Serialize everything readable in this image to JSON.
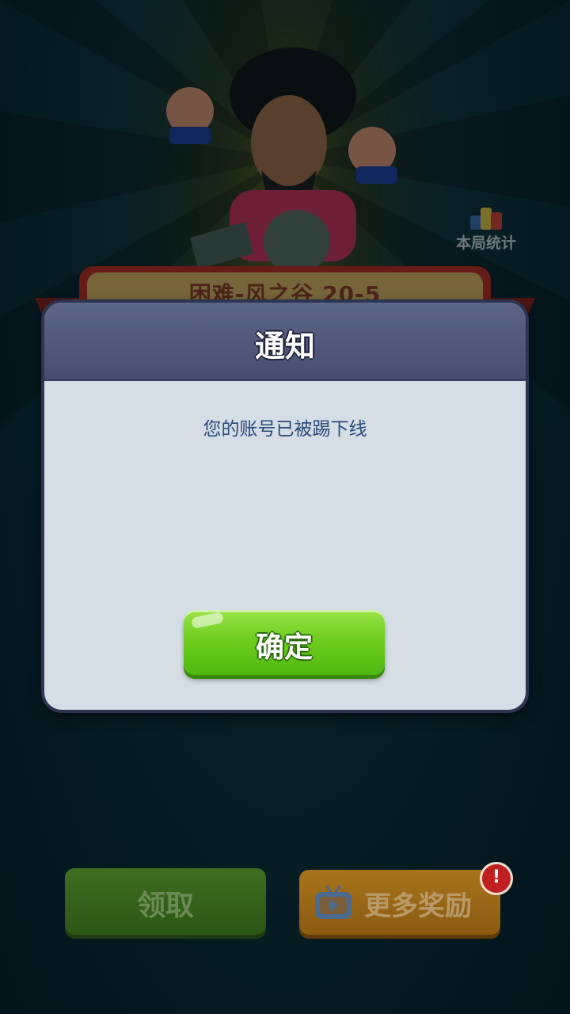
{
  "level": {
    "title": "困难-风之谷 20-5"
  },
  "stats": {
    "label": "本局统计"
  },
  "dialog": {
    "title": "通知",
    "message": "您的账号已被踢下线",
    "confirm_label": "确定"
  },
  "footer": {
    "claim_label": "领取",
    "more_rewards_label": "更多奖励",
    "alert_badge": "!"
  },
  "icons": [
    "stats-icon",
    "tv-icon",
    "alert-icon"
  ],
  "colors": {
    "confirm_green": "#6fce1f",
    "dialog_header": "#4f5779",
    "dialog_body": "#d5dde5",
    "message_text": "#2a4a78"
  }
}
